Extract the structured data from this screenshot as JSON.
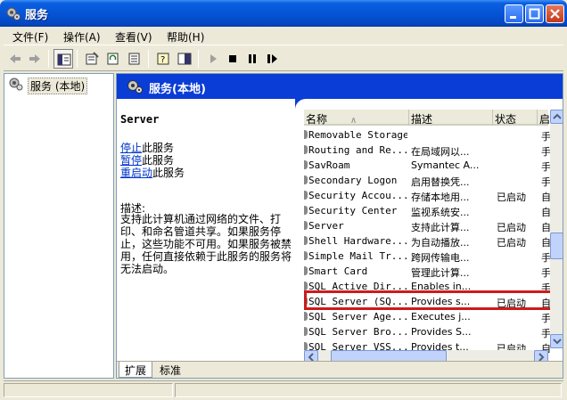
{
  "window": {
    "title": "服务"
  },
  "menu": [
    "文件(F)",
    "操作(A)",
    "查看(V)",
    "帮助(H)"
  ],
  "tree": {
    "root_label": "服务 (本地)"
  },
  "pane": {
    "header_title": "服务(本地)"
  },
  "detail": {
    "service_name": "Server",
    "actions": [
      {
        "link": "停止",
        "rest": "此服务"
      },
      {
        "link": "暂停",
        "rest": "此服务"
      },
      {
        "link": "重启动",
        "rest": "此服务"
      }
    ],
    "description_heading": "描述:",
    "description_text": "支持此计算机通过网络的文件、打印、和命名管道共享。如果服务停止，这些功能不可用。如果服务被禁用，任何直接依赖于此服务的服务将无法启动。"
  },
  "list": {
    "columns": [
      "名称",
      "描述",
      "状态",
      "启"
    ],
    "sort_indicator": "∧",
    "rows": [
      {
        "name": "Removable Storage",
        "desc": "",
        "status": "",
        "startup": "手"
      },
      {
        "name": "Routing and Re...",
        "desc": "在局域网以...",
        "status": "",
        "startup": "手"
      },
      {
        "name": "SavRoam",
        "desc": "Symantec A...",
        "status": "",
        "startup": "手"
      },
      {
        "name": "Secondary Logon",
        "desc": "启用替换凭...",
        "status": "",
        "startup": "手"
      },
      {
        "name": "Security Accou...",
        "desc": "存储本地用...",
        "status": "已启动",
        "startup": "自"
      },
      {
        "name": "Security Center",
        "desc": "监视系统安...",
        "status": "",
        "startup": "自"
      },
      {
        "name": "Server",
        "desc": "支持此计算...",
        "status": "已启动",
        "startup": "自"
      },
      {
        "name": "Shell Hardware...",
        "desc": "为自动播放...",
        "status": "已启动",
        "startup": "自"
      },
      {
        "name": "Simple Mail Tr...",
        "desc": "跨网传输电...",
        "status": "",
        "startup": "手"
      },
      {
        "name": "Smart Card",
        "desc": "管理此计算...",
        "status": "",
        "startup": "手"
      },
      {
        "name": "SQL Active Dir...",
        "desc": "Enables in...",
        "status": "",
        "startup": "手"
      },
      {
        "name": "SQL Server (SQ...",
        "desc": "Provides s...",
        "status": "已启动",
        "startup": "自"
      },
      {
        "name": "SQL Server Age...",
        "desc": "Executes j...",
        "status": "",
        "startup": "手"
      },
      {
        "name": "SQL Server Bro...",
        "desc": "Provides S...",
        "status": "",
        "startup": "手"
      },
      {
        "name": "SQL Server VSS...",
        "desc": "Provides t...",
        "status": "已启动",
        "startup": "自"
      }
    ]
  },
  "tabs": [
    "扩展",
    "标准"
  ],
  "colors": {
    "title_blue": "#0555d6",
    "header_blue": "#0a3cd6",
    "highlight_red": "#cc1b1b",
    "link_blue": "#0033cc"
  }
}
